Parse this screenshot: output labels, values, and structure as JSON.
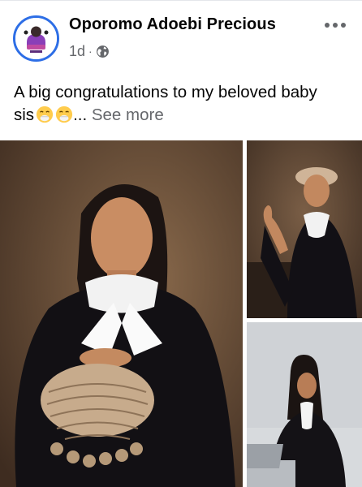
{
  "post": {
    "author": "Oporomo Adoebi Precious",
    "timestamp": "1d",
    "separator": "·",
    "privacy_icon": "globe-icon",
    "text_line1": "A big congratulations to my beloved baby",
    "text_line2_prefix": "sis",
    "emojis": [
      "face-with-hand-over-mouth",
      "face-with-hand-over-mouth"
    ],
    "ellipsis": "...",
    "see_more_label": "See more",
    "menu_icon": "more-horizontal-icon"
  },
  "colors": {
    "text": "#050505",
    "secondary_text": "#65676b",
    "avatar_ring": "#2d6ee6",
    "background": "#ffffff"
  },
  "photos": [
    {
      "subject": "woman in black legal robe and white bands holding barrister wig"
    },
    {
      "subject": "woman wearing barrister wig seated, waving"
    },
    {
      "subject": "woman in robe seated at desk with laptop"
    }
  ]
}
